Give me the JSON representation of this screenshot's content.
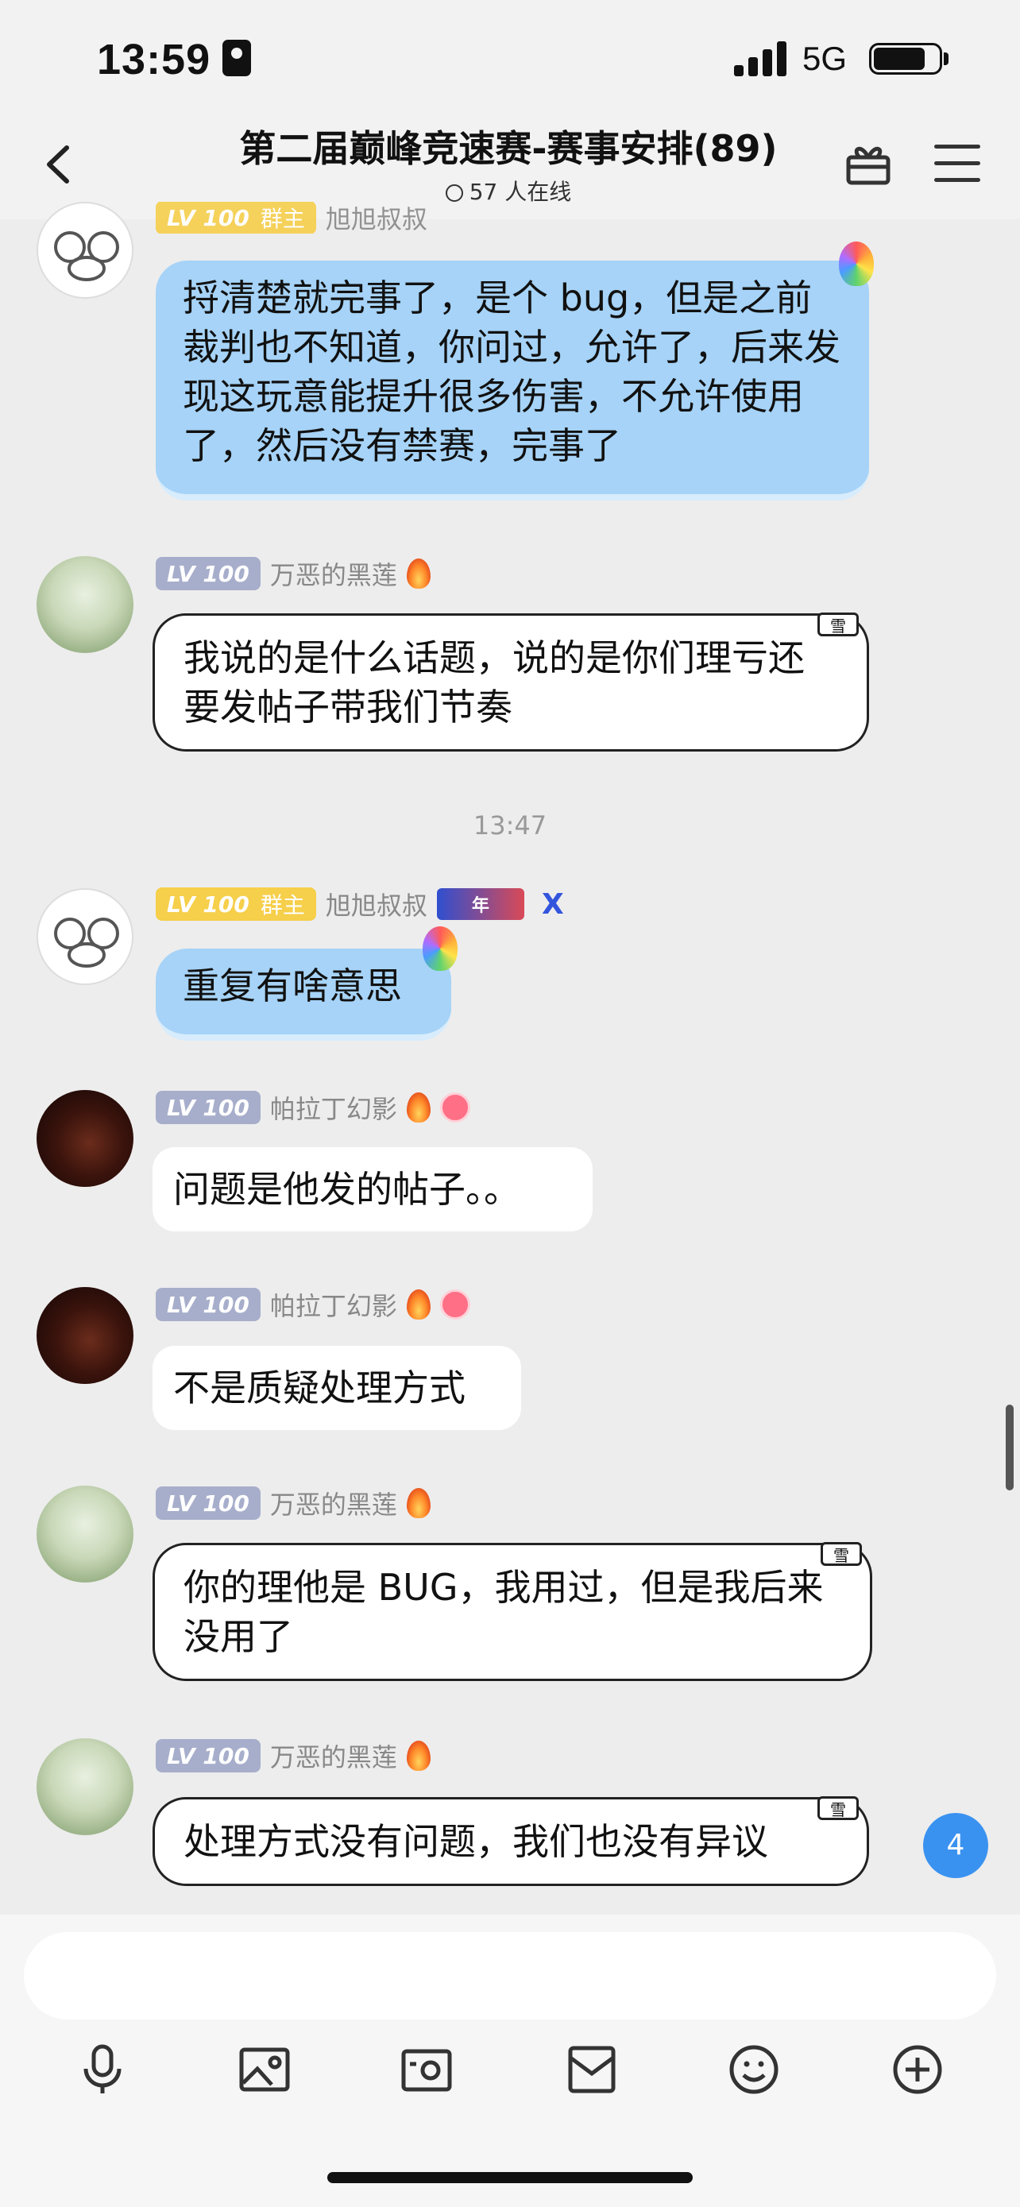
{
  "status": {
    "time": "13:59",
    "network": "5G"
  },
  "header": {
    "back_icon": "chevron-left-icon",
    "title": "第二届巅峰竞速赛-赛事安排(89)",
    "online": "57 人在线",
    "gift_icon": "gift-icon",
    "menu_icon": "menu-icon"
  },
  "levels": {
    "lv": "LV 100",
    "owner": "群主"
  },
  "tags": {
    "tag1": "年",
    "tag2": "X"
  },
  "messages": {
    "m1": {
      "sender": "旭旭叔叔",
      "text": "捋清楚就完事了，是个 bug，但是之前裁判也不知道，你问过，允许了，后来发现这玩意能提升很多伤害，不允许使用了，然后没有禁赛，完事了"
    },
    "m2": {
      "sender": "万恶的黑莲",
      "text": "我说的是什么话题，说的是你们理亏还要发帖子带我们节奏"
    },
    "timestamp": "13:47",
    "m3": {
      "sender": "旭旭叔叔",
      "text": "重复有啥意思"
    },
    "m4": {
      "sender": "帕拉丁幻影",
      "text": "问题是他发的帖子。。"
    },
    "m5": {
      "sender": "帕拉丁幻影",
      "text": "不是质疑处理方式"
    },
    "m6": {
      "sender": "万恶的黑莲",
      "text": "你的理他是 BUG，我用过，但是我后来没用了"
    },
    "m7": {
      "sender": "万恶的黑莲",
      "text": "处理方式没有问题，我们也没有异议"
    }
  },
  "comic_tag": "雪",
  "unread_count": "4",
  "toolbar": {
    "icons": [
      "mic-icon",
      "image-icon",
      "camera-icon",
      "envelope-icon",
      "emoji-icon",
      "plus-icon"
    ]
  }
}
